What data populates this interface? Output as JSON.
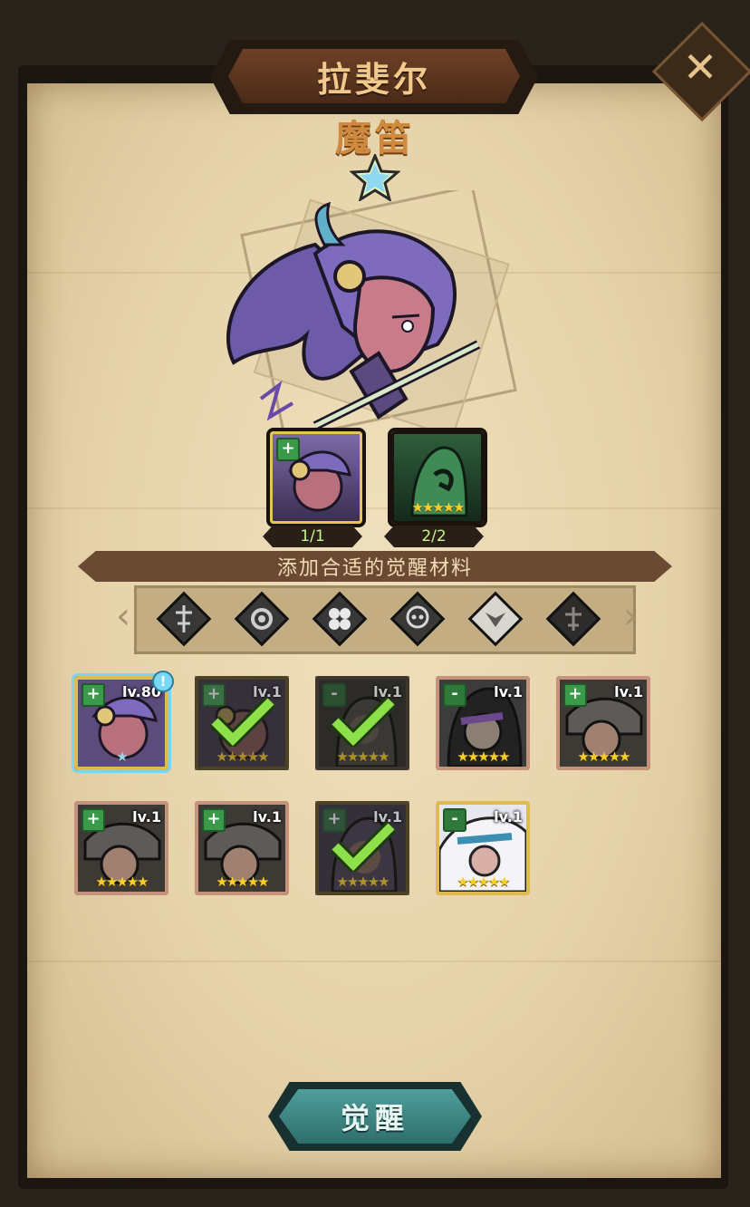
{
  "header": {
    "title": "拉斐尔",
    "close_icon": "close-icon"
  },
  "hero": {
    "class_name": "魔笛",
    "rank_star_icon": "star-icon"
  },
  "materials": [
    {
      "counter": "1/1",
      "stars": ""
    },
    {
      "counter": "2/2",
      "stars": "★★★★★"
    }
  ],
  "banner": {
    "text": "添加合适的觉醒材料"
  },
  "filters": [
    "elf-icon",
    "gear-icon",
    "clover-icon",
    "skull-icon",
    "crest-icon",
    "demon-icon"
  ],
  "cards": [
    {
      "level": "lv.80",
      "stars": "★",
      "selected": true,
      "checked": false,
      "alert": "!"
    },
    {
      "level": "lv.1",
      "stars": "★★★★★",
      "selected": false,
      "checked": true
    },
    {
      "level": "lv.1",
      "stars": "★★★★★",
      "selected": false,
      "checked": true
    },
    {
      "level": "lv.1",
      "stars": "★★★★★",
      "selected": false,
      "checked": false
    },
    {
      "level": "lv.1",
      "stars": "★★★★★",
      "selected": false,
      "checked": false
    },
    {
      "level": "lv.1",
      "stars": "★★★★★",
      "selected": false,
      "checked": false
    },
    {
      "level": "lv.1",
      "stars": "★★★★★",
      "selected": false,
      "checked": false
    },
    {
      "level": "lv.1",
      "stars": "★★★★★",
      "selected": false,
      "checked": true
    },
    {
      "level": "lv.1",
      "stars": "★★★★★",
      "selected": false,
      "checked": false
    }
  ],
  "footer": {
    "awaken_label": "觉醒"
  },
  "colors": {
    "paper": "#e9d8b2",
    "accent_teal": "#3f8a87",
    "check_green": "#8ee04a",
    "card_border": "#c5927c"
  }
}
